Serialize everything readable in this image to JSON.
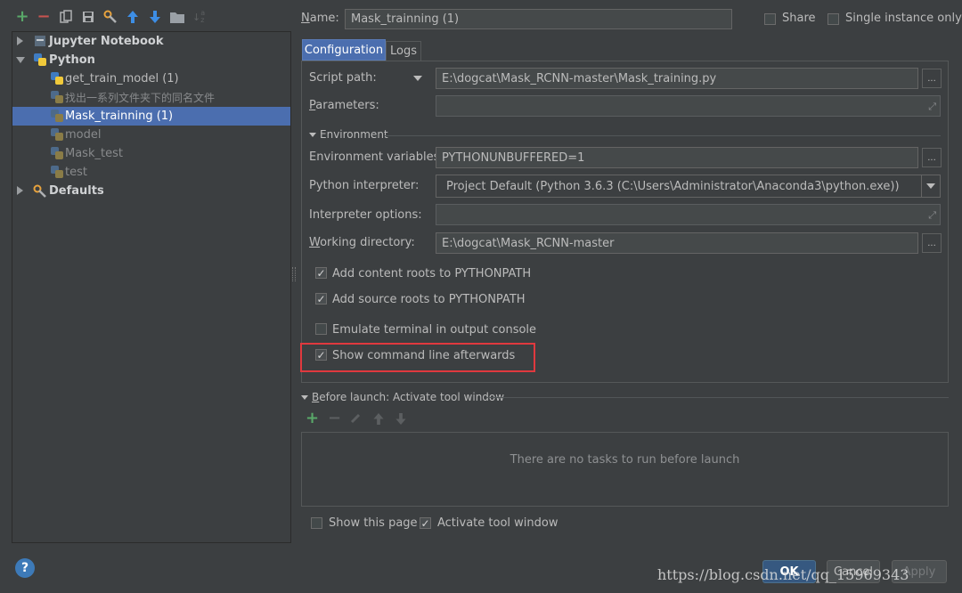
{
  "toolbar": {
    "icons": [
      "add-icon",
      "remove-icon",
      "copy-icon",
      "save-icon",
      "wrench-icon",
      "move-up-icon",
      "move-down-icon",
      "folder-icon",
      "sort-icon"
    ]
  },
  "tree": {
    "items": [
      {
        "label": "Jupyter Notebook",
        "kind": "group",
        "expanded": false
      },
      {
        "label": "Python",
        "kind": "group",
        "expanded": true
      },
      {
        "label": "get_train_model (1)",
        "kind": "config"
      },
      {
        "label": "找出一系列文件夹下的同名文件",
        "kind": "config-temp"
      },
      {
        "label": "Mask_trainning (1)",
        "kind": "config",
        "selected": true
      },
      {
        "label": "model",
        "kind": "config-temp"
      },
      {
        "label": "Mask_test",
        "kind": "config-temp"
      },
      {
        "label": "test",
        "kind": "config-temp"
      },
      {
        "label": "Defaults",
        "kind": "group",
        "expanded": false
      }
    ]
  },
  "header": {
    "name_label": "Name:",
    "name_value": "Mask_trainning (1)",
    "share_label": "Share",
    "share_checked": false,
    "single_instance_label": "Single instance only",
    "single_instance_checked": false
  },
  "tabs": [
    {
      "label": "Configuration",
      "active": true
    },
    {
      "label": "Logs",
      "active": false
    }
  ],
  "config": {
    "script_path_label": "Script path:",
    "script_path_value": "E:\\dogcat\\Mask_RCNN-master\\Mask_training.py",
    "parameters_label": "Parameters:",
    "parameters_value": "",
    "environment_section": "Environment",
    "env_vars_label": "Environment variables:",
    "env_vars_value": "PYTHONUNBUFFERED=1",
    "interpreter_label": "Python interpreter:",
    "interpreter_value": "Project Default (Python 3.6.3 (C:\\Users\\Administrator\\Anaconda3\\python.exe))",
    "interp_options_label": "Interpreter options:",
    "interp_options_value": "",
    "working_dir_label": "Working directory:",
    "working_dir_value": "E:\\dogcat\\Mask_RCNN-master",
    "ellipsis": "...",
    "checkboxes": [
      {
        "label": "Add content roots to PYTHONPATH",
        "checked": true
      },
      {
        "label": "Add source roots to PYTHONPATH",
        "checked": true
      },
      {
        "label": "Emulate terminal in output console",
        "checked": false
      },
      {
        "label": "Show command line afterwards",
        "checked": true
      }
    ]
  },
  "before_launch": {
    "title": "Before launch: Activate tool window",
    "empty_text": "There are no tasks to run before launch",
    "show_page_label": "Show this page",
    "show_page_checked": false,
    "activate_tool_label": "Activate tool window",
    "activate_tool_checked": true
  },
  "footer": {
    "help": "?",
    "ok": "OK",
    "cancel": "Cancel",
    "apply": "Apply",
    "watermark": "https://blog.csdn.net/qq_15969343"
  },
  "colors": {
    "background": "#3c3f41",
    "selection": "#4b6eaf",
    "highlight_box": "#e0393e",
    "add_green": "#59a869",
    "remove_red": "#c75450"
  }
}
